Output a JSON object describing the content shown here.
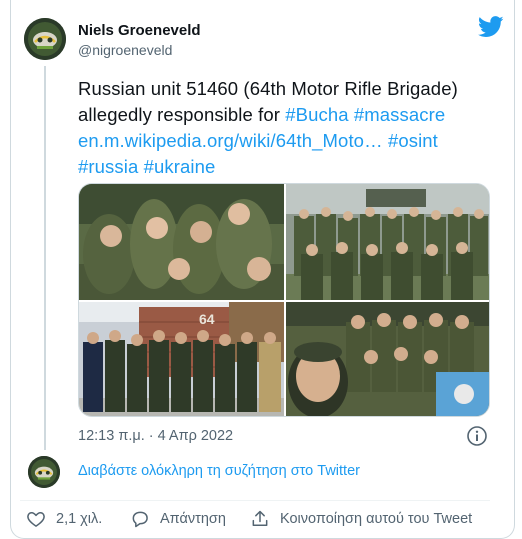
{
  "author": {
    "name": "Niels Groeneveld",
    "handle": "@nigroeneveld"
  },
  "icons": {
    "brand": "twitter-bird-icon",
    "info": "info-icon",
    "like": "heart-icon",
    "reply": "reply-icon",
    "share": "share-icon"
  },
  "colors": {
    "link": "#1d9bf0",
    "text": "#0f1419",
    "muted": "#536471",
    "border": "#cfd9de"
  },
  "tweet": {
    "line1": "Russian unit 51460 (64th Motor Rifle Brigade)",
    "line2_text": "allegedly responsible for ",
    "hashtag_bucha": "#Bucha",
    "hashtag_massacre": "#massacre",
    "link_url": "en.m.wikipedia.org/wiki/64th_Moto…",
    "hashtag_osint": "#osint",
    "hashtag_russia": "#russia",
    "hashtag_ukraine": "#ukraine"
  },
  "media": {
    "photo_count": 4,
    "overlay_text": "64"
  },
  "meta": {
    "timestamp": "12:13 π.μ. · 4 Απρ 2022"
  },
  "conversation": {
    "link_label": "Διαβάστε ολόκληρη τη συζήτηση στο Twitter"
  },
  "actions": {
    "like_count": "2,1 χιλ.",
    "reply_label": "Απάντηση",
    "share_label": "Κοινοποίηση αυτού του Tweet"
  }
}
